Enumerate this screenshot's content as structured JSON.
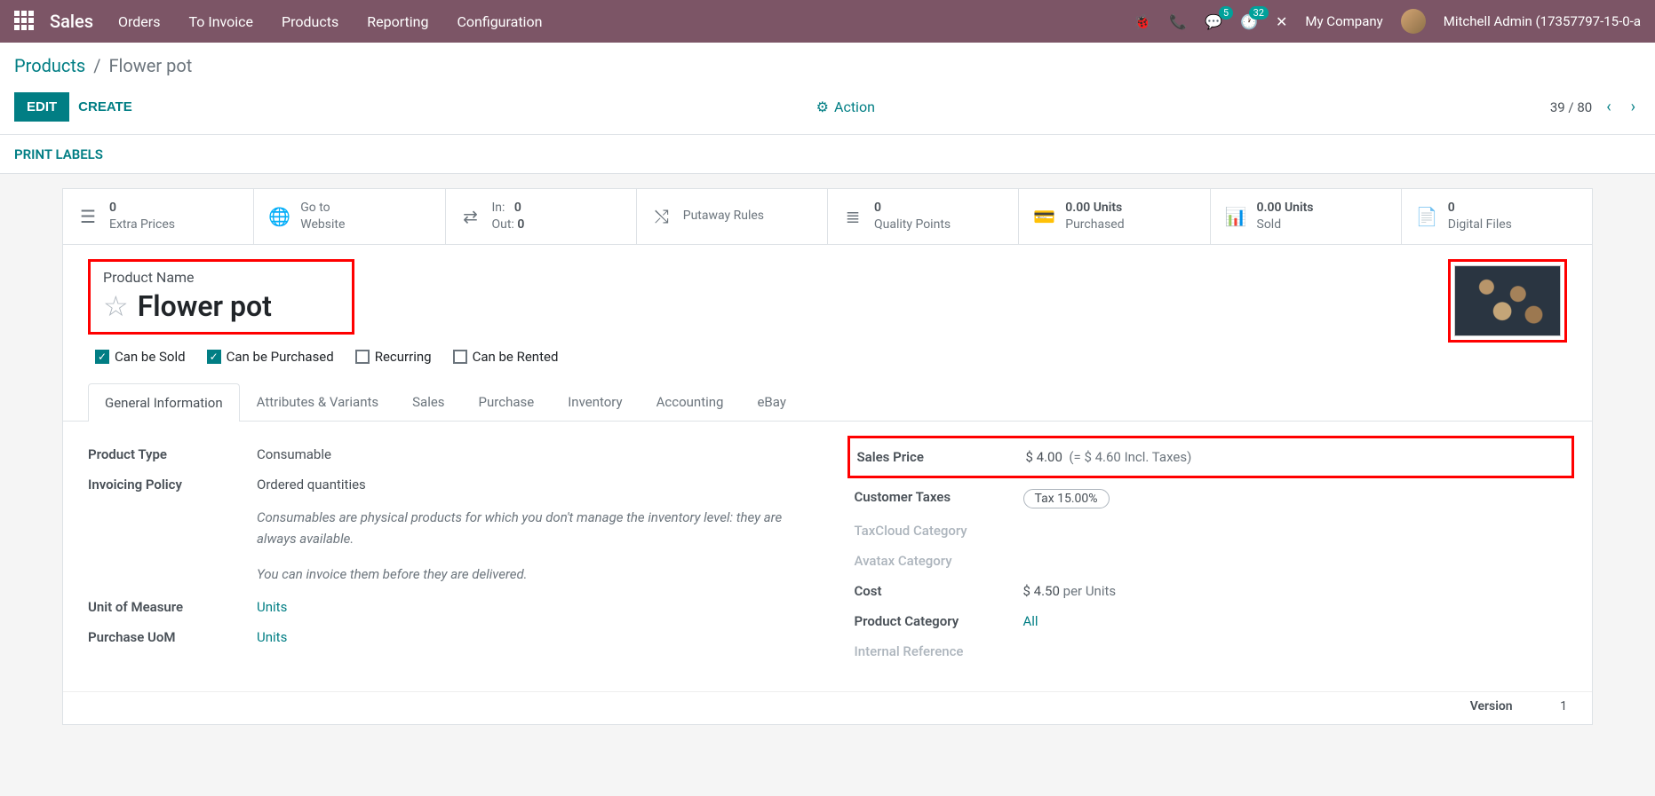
{
  "topnav": {
    "brand": "Sales",
    "menu": [
      "Orders",
      "To Invoice",
      "Products",
      "Reporting",
      "Configuration"
    ],
    "msg_badge": "5",
    "activity_badge": "32",
    "company": "My Company",
    "user": "Mitchell Admin (17357797-15-0-a"
  },
  "breadcrumb": {
    "parent": "Products",
    "current": "Flower pot"
  },
  "actions": {
    "edit": "EDIT",
    "create": "CREATE",
    "action": "Action",
    "pager": "39 / 80"
  },
  "print_labels": "PRINT LABELS",
  "stats": {
    "extra_prices": {
      "v": "0",
      "l": "Extra Prices"
    },
    "website": {
      "l1": "Go to",
      "l2": "Website"
    },
    "inout": {
      "in_l": "In:",
      "in_v": "0",
      "out_l": "Out:",
      "out_v": "0"
    },
    "putaway": {
      "l": "Putaway Rules"
    },
    "quality": {
      "v": "0",
      "l": "Quality Points"
    },
    "purchased": {
      "v": "0.00 Units",
      "l": "Purchased"
    },
    "sold": {
      "v": "0.00 Units",
      "l": "Sold"
    },
    "files": {
      "v": "0",
      "l": "Digital Files"
    }
  },
  "product": {
    "name_label": "Product Name",
    "name": "Flower pot",
    "checks": {
      "sold": "Can be Sold",
      "purchased": "Can be Purchased",
      "recurring": "Recurring",
      "rented": "Can be Rented"
    }
  },
  "tabs": [
    "General Information",
    "Attributes & Variants",
    "Sales",
    "Purchase",
    "Inventory",
    "Accounting",
    "eBay"
  ],
  "form": {
    "left": {
      "product_type": {
        "l": "Product Type",
        "v": "Consumable"
      },
      "invoicing_policy": {
        "l": "Invoicing Policy",
        "v": "Ordered quantities"
      },
      "help1": "Consumables are physical products for which you don't manage the inventory level: they are always available.",
      "help2": "You can invoice them before they are delivered.",
      "uom": {
        "l": "Unit of Measure",
        "v": "Units"
      },
      "puom": {
        "l": "Purchase UoM",
        "v": "Units"
      }
    },
    "right": {
      "sales_price": {
        "l": "Sales Price",
        "v": "$ 4.00",
        "incl": "(= $ 4.60 Incl. Taxes)"
      },
      "customer_taxes": {
        "l": "Customer Taxes",
        "v": "Tax 15.00%"
      },
      "taxcloud": {
        "l": "TaxCloud Category"
      },
      "avatax": {
        "l": "Avatax Category"
      },
      "cost": {
        "l": "Cost",
        "v": "$ 4.50",
        "per": "per Units"
      },
      "category": {
        "l": "Product Category",
        "v": "All"
      },
      "internal_ref": {
        "l": "Internal Reference"
      }
    }
  },
  "version": {
    "l": "Version",
    "v": "1"
  }
}
